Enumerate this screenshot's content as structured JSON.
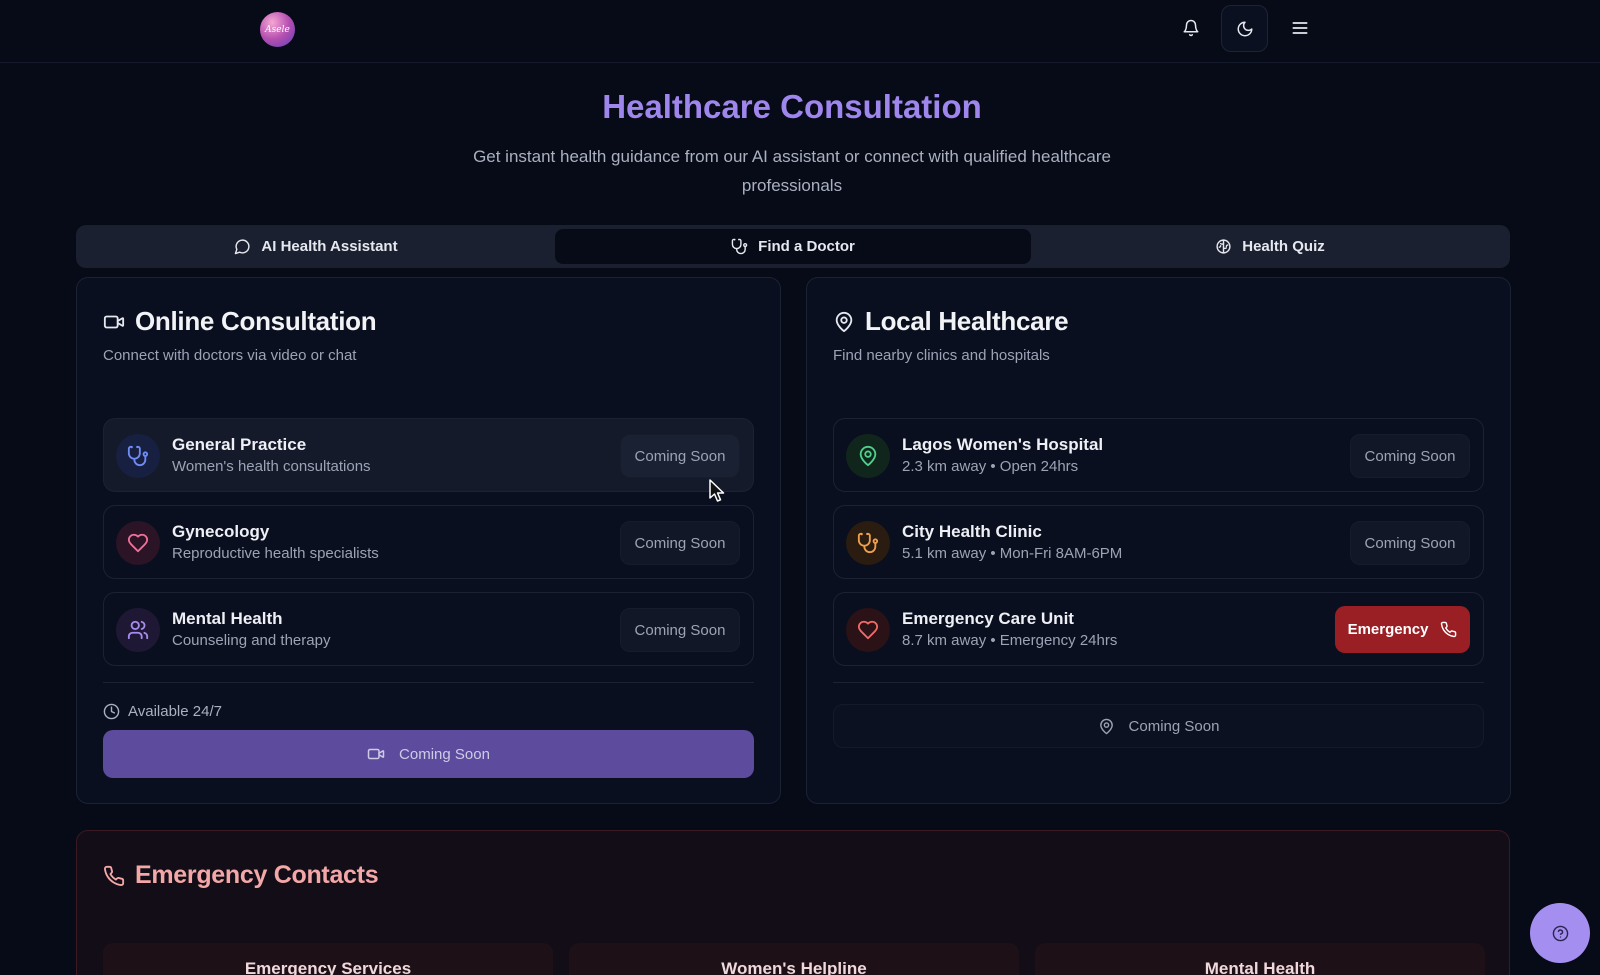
{
  "topbar": {
    "logo_text": "Asele",
    "icons": [
      "bell-icon",
      "moon-icon",
      "menu-icon"
    ]
  },
  "hero": {
    "title": "Healthcare Consultation",
    "subtitle": "Get instant health guidance from our AI assistant or connect with qualified healthcare professionals"
  },
  "tabs": [
    {
      "label": "AI Health Assistant",
      "icon": "message-circle-icon"
    },
    {
      "label": "Find a Doctor",
      "icon": "stethoscope-icon",
      "active": true
    },
    {
      "label": "Health Quiz",
      "icon": "brain-icon"
    }
  ],
  "online": {
    "title": "Online Consultation",
    "subtitle": "Connect with doctors via video or chat",
    "items": [
      {
        "title": "General Practice",
        "desc": "Women's health consultations",
        "button": "Coming Soon",
        "icon": "stethoscope-icon",
        "color": "#6f8cf6"
      },
      {
        "title": "Gynecology",
        "desc": "Reproductive health specialists",
        "button": "Coming Soon",
        "icon": "heart-icon",
        "color": "#f0709a"
      },
      {
        "title": "Mental Health",
        "desc": "Counseling and therapy",
        "button": "Coming Soon",
        "icon": "users-icon",
        "color": "#a98bf0"
      }
    ],
    "available": "Available 24/7",
    "cta": "Coming Soon"
  },
  "local": {
    "title": "Local Healthcare",
    "subtitle": "Find nearby clinics and hospitals",
    "items": [
      {
        "title": "Lagos Women's Hospital",
        "desc": "2.3 km away • Open 24hrs",
        "button": "Coming Soon",
        "icon": "map-pin-icon",
        "color": "#4fd18b"
      },
      {
        "title": "City Health Clinic",
        "desc": "5.1 km away • Mon-Fri 8AM-6PM",
        "button": "Coming Soon",
        "icon": "stethoscope-icon",
        "color": "#f0a04b"
      },
      {
        "title": "Emergency Care Unit",
        "desc": "8.7 km away • Emergency 24hrs",
        "button": "Emergency",
        "icon": "heart-icon",
        "color": "#f06a6a"
      }
    ],
    "cta": "Coming Soon"
  },
  "emergency": {
    "title": "Emergency Contacts",
    "items": [
      "Emergency Services",
      "Women's Helpline",
      "Mental Health"
    ]
  },
  "colors": {
    "accent": "#9f86ec",
    "emergency": "#9a1f24",
    "background": "#070b18"
  }
}
